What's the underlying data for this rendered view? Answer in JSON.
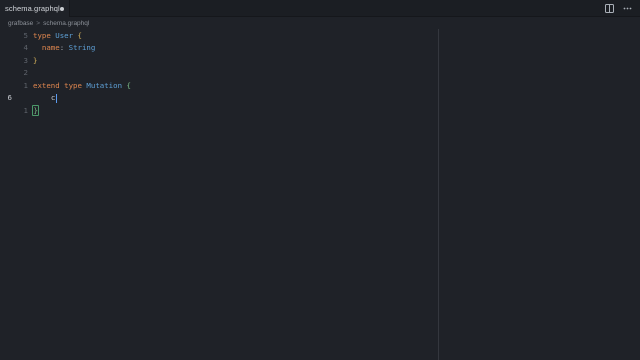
{
  "tabs": [
    {
      "label": "schema.graphql",
      "dirty": true
    }
  ],
  "breadcrumb": [
    "grafbase",
    "schema.graphql"
  ],
  "breadcrumb_separator": ">",
  "tab_actions": [
    "split-editor-icon",
    "more-actions-icon"
  ],
  "editor": {
    "lines": [
      {
        "number": "5",
        "tokens": [
          [
            "kw",
            "type"
          ],
          [
            "plain",
            " "
          ],
          [
            "type",
            "User"
          ],
          [
            "plain",
            " "
          ],
          [
            "brace",
            "{"
          ]
        ]
      },
      {
        "number": "4",
        "tokens": [
          [
            "plain",
            "  "
          ],
          [
            "field",
            "name"
          ],
          [
            "punct",
            ":"
          ],
          [
            "plain",
            " "
          ],
          [
            "type",
            "String"
          ]
        ]
      },
      {
        "number": "3",
        "tokens": [
          [
            "brace",
            "}"
          ]
        ]
      },
      {
        "number": "2",
        "tokens": []
      },
      {
        "number": "1",
        "tokens": [
          [
            "kw",
            "extend"
          ],
          [
            "plain",
            " "
          ],
          [
            "kw",
            "type"
          ],
          [
            "plain",
            " "
          ],
          [
            "type",
            "Mutation"
          ],
          [
            "plain",
            " "
          ],
          [
            "brace-green",
            "{"
          ]
        ]
      },
      {
        "number": "6",
        "active": true,
        "tokens": [
          [
            "plain",
            "    "
          ],
          [
            "cursor",
            "c"
          ]
        ]
      },
      {
        "number": "1",
        "tokens": [
          [
            "brace-green-box",
            "}"
          ]
        ]
      }
    ]
  },
  "colors": {
    "background": "#1f2228",
    "keyword": "#e0874f",
    "type": "#5ea0d6",
    "brace": "#d7b35b",
    "bracket_match": "#7dbf8a",
    "caret": "#5b9bf0"
  }
}
